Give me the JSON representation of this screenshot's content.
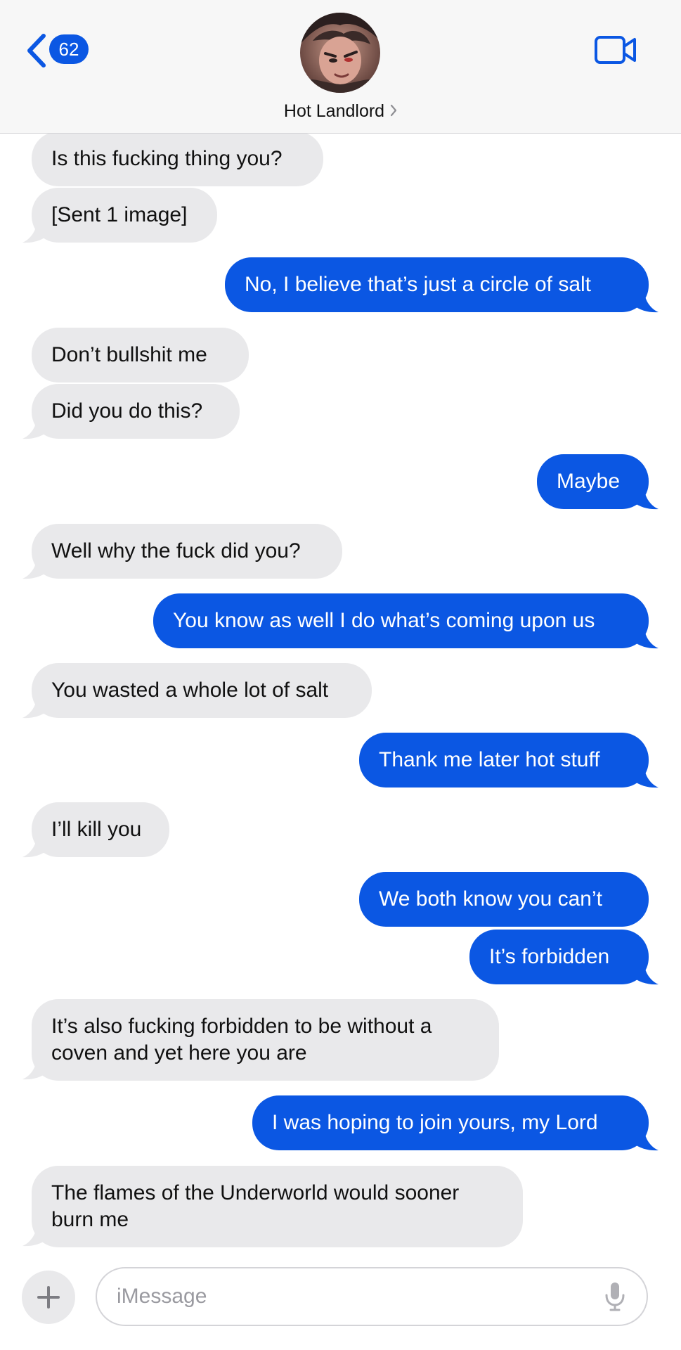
{
  "header": {
    "unread_count": "62",
    "contact_name": "Hot Landlord",
    "avatar_icon": "profile-photo",
    "back_icon": "chevron-left-icon",
    "video_icon": "video-camera-icon",
    "accent_color": "#0b57e3"
  },
  "messages": [
    {
      "from": "them",
      "text": "Is this fucking thing you?"
    },
    {
      "from": "them",
      "text": "[Sent 1 image]"
    },
    {
      "from": "me",
      "text": "No, I believe that’s just a circle of salt"
    },
    {
      "from": "them",
      "text": "Don’t bullshit me"
    },
    {
      "from": "them",
      "text": "Did you do this?"
    },
    {
      "from": "me",
      "text": "Maybe"
    },
    {
      "from": "them",
      "text": "Well why the fuck did you?"
    },
    {
      "from": "me",
      "text": "You know as well I do what’s coming upon us"
    },
    {
      "from": "them",
      "text": "You wasted a whole lot of salt"
    },
    {
      "from": "me",
      "text": "Thank me later hot stuff"
    },
    {
      "from": "them",
      "text": "I’ll kill you"
    },
    {
      "from": "me",
      "text": "We both know you can’t"
    },
    {
      "from": "me",
      "text": "It’s forbidden"
    },
    {
      "from": "them",
      "text": "It’s also fucking forbidden to be without a coven and yet here you are"
    },
    {
      "from": "me",
      "text": "I was hoping to join yours, my Lord"
    },
    {
      "from": "them",
      "text": "The flames of the Underworld would sooner burn me"
    }
  ],
  "composer": {
    "placeholder": "iMessage",
    "plus_icon": "plus-icon",
    "mic_icon": "microphone-icon"
  }
}
